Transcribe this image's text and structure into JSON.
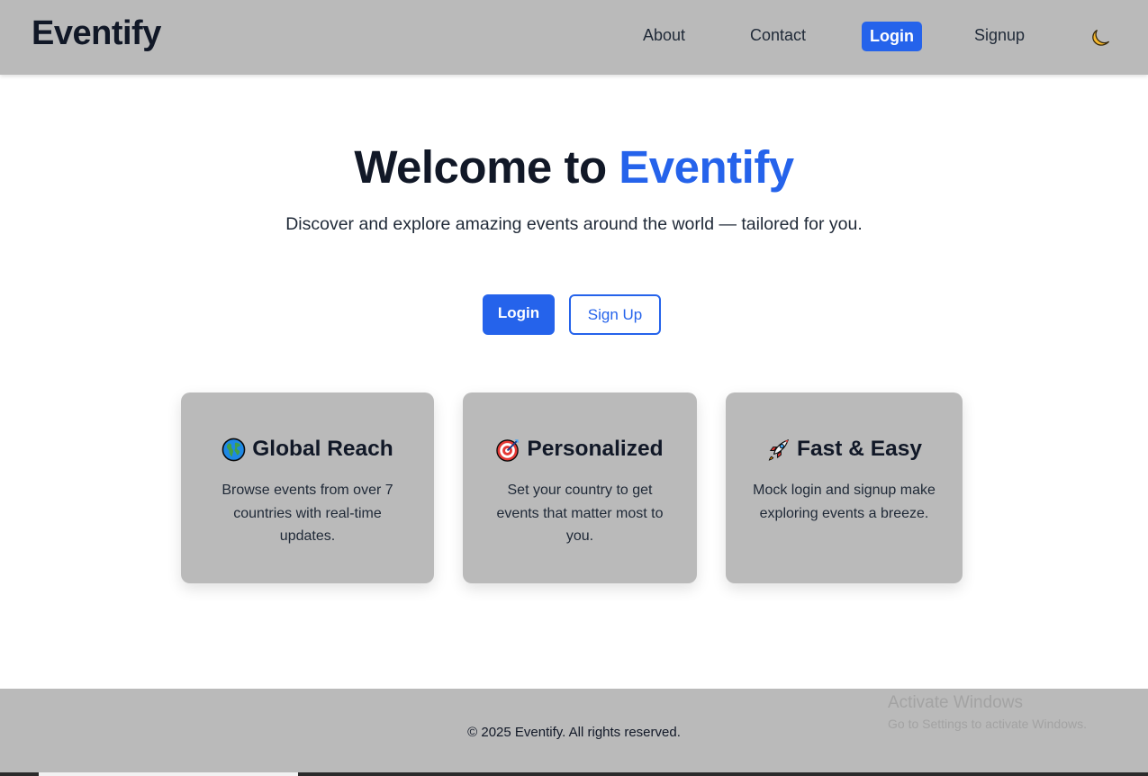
{
  "nav": {
    "brand": "Eventify",
    "links": {
      "about": "About",
      "contact": "Contact",
      "login": "Login",
      "signup": "Signup"
    },
    "theme_icon": "moon-icon"
  },
  "hero": {
    "title_prefix": "Welcome to",
    "title_accent": "Eventify",
    "subtitle": "Discover and explore amazing events around the world — tailored for you.",
    "login_label": "Login",
    "signup_label": "Sign Up"
  },
  "features": [
    {
      "icon": "globe-icon",
      "title": "Global Reach",
      "text": "Browse events from over 7 countries with real-time updates."
    },
    {
      "icon": "target-icon",
      "title": "Personalized",
      "text": "Set your country to get events that matter most to you."
    },
    {
      "icon": "rocket-icon",
      "title": "Fast & Easy",
      "text": "Mock login and signup make exploring events a breeze."
    }
  ],
  "footer": {
    "text": "© 2025 Eventify. All rights reserved."
  },
  "watermark": {
    "title": "Activate Windows",
    "subtitle": "Go to Settings to activate Windows."
  },
  "colors": {
    "accent": "#2563eb",
    "bar_bg": "#bababa",
    "text_dark": "#111827"
  }
}
